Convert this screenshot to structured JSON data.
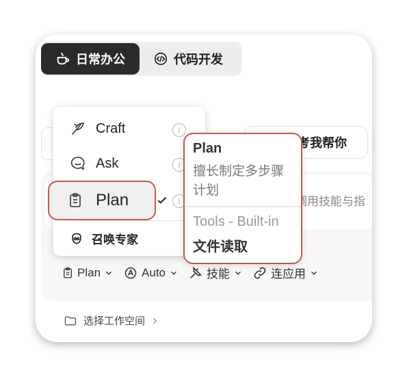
{
  "tabs": {
    "active": {
      "label": "日常办公",
      "icon": "coffee-cup-icon"
    },
    "other": {
      "label": "代码开发",
      "icon": "code-icon"
    }
  },
  "background": {
    "chip_text": "考我帮你",
    "input_placeholder": "调用技能与指"
  },
  "toolbar": {
    "plan": "Plan",
    "auto": "Auto",
    "skills": "技能",
    "connect": "连应用"
  },
  "workspace": {
    "label": "选择工作空间"
  },
  "menu": {
    "items": [
      {
        "label": "Craft",
        "icon": "craft-feather-icon"
      },
      {
        "label": "Ask",
        "icon": "chat-bubble-icon"
      },
      {
        "label": "Plan",
        "icon": "clipboard-icon",
        "selected": true
      }
    ],
    "expert": {
      "label": "召唤专家",
      "icon": "expert-icon"
    }
  },
  "tooltip": {
    "title": "Plan",
    "description": "擅长制定多步骤计划",
    "tools_label": "Tools - Built-in",
    "tool": "文件读取"
  },
  "colors": {
    "highlight_border": "#c8574a",
    "dark_tab": "#2b2b2b"
  }
}
